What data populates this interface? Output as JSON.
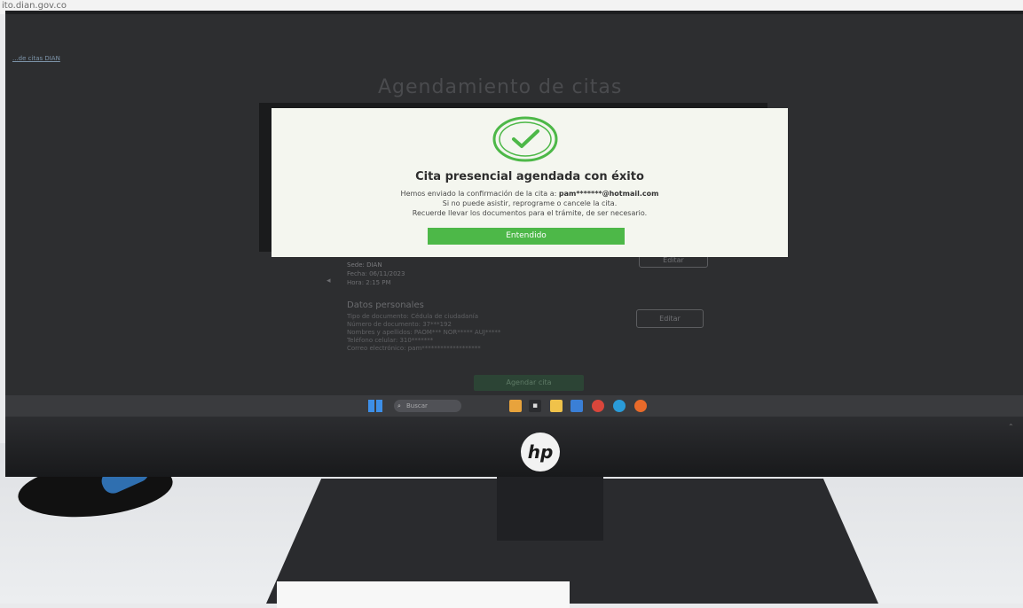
{
  "browser": {
    "url": "ito.dian.gov.co"
  },
  "page": {
    "breadcrumb": "...de citas DIAN",
    "title": "Agendamiento de citas"
  },
  "modal": {
    "title": "Cita presencial agendada con éxito",
    "line1_prefix": "Hemos enviado la confirmación de la cita a:",
    "line1_email": "pam*******@hotmail.com",
    "line2": "Si no puede asistir, reprograme o cancele la cita.",
    "line3": "Recuerde llevar los documentos para el trámite, de ser necesario.",
    "button": "Entendido",
    "accent_color": "#4db848",
    "icon": "check-circle-icon"
  },
  "appointment_summary": {
    "line1": "Sede: DIAN",
    "line2": "Fecha: 06/11/2023",
    "line3": "Hora: 2:15 PM",
    "edit_label": "Editar"
  },
  "personal_data": {
    "title": "Datos personales",
    "lines": [
      "Tipo de documento: Cédula de ciudadanía",
      "Número de documento: 37***192",
      "Nombres y apellidos: PAOM*** NOR***** AUJ*****",
      "Teléfono celular: 310*******",
      "Correo electrónico: pam*******************"
    ],
    "edit_label": "Editar"
  },
  "finish_button": "Agendar cita",
  "taskbar": {
    "search_placeholder": "Buscar",
    "icons": [
      "windows-start-icon",
      "search-icon",
      "widgets-icon",
      "task-view-icon",
      "file-explorer-icon",
      "mail-icon",
      "chrome-icon",
      "edge-icon",
      "firefox-icon"
    ]
  },
  "monitor_brand": "hp"
}
